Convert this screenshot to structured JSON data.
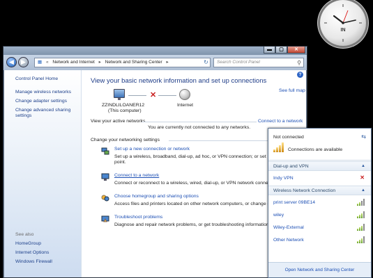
{
  "gadget": {
    "mark": "IN"
  },
  "window": {
    "controls": {
      "minimize": "▬",
      "maximize": "▢",
      "close": "✕"
    },
    "address": [
      "Network and Internet",
      "Network and Sharing Center"
    ],
    "search_placeholder": "Search Control Panel"
  },
  "sidebar": {
    "home": "Control Panel Home",
    "links": [
      "Manage wireless networks",
      "Change adapter settings",
      "Change advanced sharing settings"
    ],
    "see_also_label": "See also",
    "see_also": [
      "HomeGroup",
      "Internet Options",
      "Windows Firewall"
    ]
  },
  "main": {
    "title": "View your basic network information and set up connections",
    "see_full_map": "See full map",
    "computer_name": "ZZINDLILOANER12",
    "computer_caption": "(This computer)",
    "internet_label": "Internet",
    "active_label": "View your active networks",
    "connect_link": "Connect to a network",
    "not_connected_msg": "You are currently not connected to any networks.",
    "change_label": "Change your networking settings",
    "tasks": [
      {
        "title": "Set up a new connection or network",
        "desc1": "Set up a wireless, broadband, dial-up, ad hoc, or VPN connection; or set",
        "desc2": "point."
      },
      {
        "title": "Connect to a network",
        "desc1": "Connect or reconnect to a wireless, wired, dial-up, or VPN network connection",
        "desc2": ""
      },
      {
        "title": "Choose homegroup and sharing options",
        "desc1": "Access files and printers located on other network computers, or change sharin",
        "desc2": ""
      },
      {
        "title": "Troubleshoot problems",
        "desc1": "Diagnose and repair network problems, or get troubleshooting information.",
        "desc2": ""
      }
    ]
  },
  "flyout": {
    "status": "Not connected",
    "available": "Connections are available",
    "dialup_section": "Dial-up and VPN",
    "vpn": "Indy VPN",
    "wireless_section": "Wireless Network Connection",
    "networks": [
      {
        "name": "print server 09BE14",
        "bars": 2
      },
      {
        "name": "wiley",
        "bars": 3
      },
      {
        "name": "Wiley-External",
        "bars": 3
      },
      {
        "name": "Other Network",
        "bars": 3
      }
    ],
    "footer": "Open Network and Sharing Center"
  }
}
